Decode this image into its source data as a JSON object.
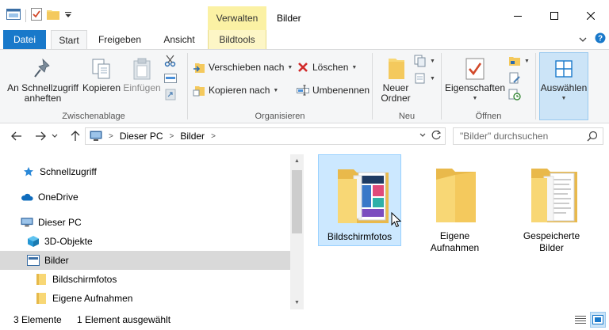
{
  "window": {
    "title": "Bilder",
    "context_header": "Verwalten"
  },
  "tabs": {
    "datei": "Datei",
    "start": "Start",
    "freigeben": "Freigeben",
    "ansicht": "Ansicht",
    "bildtools": "Bildtools"
  },
  "ribbon": {
    "zwischenablage": {
      "label": "Zwischenablage",
      "pin_line1": "An Schnellzugriff",
      "pin_line2": "anheften",
      "copy": "Kopieren",
      "paste": "Einfügen"
    },
    "organisieren": {
      "label": "Organisieren",
      "move_to": "Verschieben nach",
      "copy_to": "Kopieren nach",
      "delete": "Löschen",
      "rename": "Umbenennen"
    },
    "neu": {
      "label": "Neu",
      "new_folder_line1": "Neuer",
      "new_folder_line2": "Ordner"
    },
    "oeffnen": {
      "label": "Öffnen",
      "properties": "Eigenschaften"
    },
    "auswaehlen": {
      "select": "Auswählen"
    }
  },
  "address": {
    "crumbs": [
      "Dieser PC",
      "Bilder"
    ],
    "search_placeholder": "\"Bilder\" durchsuchen"
  },
  "navpane": {
    "items": [
      {
        "label": "Schnellzugriff"
      },
      {
        "label": "OneDrive"
      },
      {
        "label": "Dieser PC"
      },
      {
        "label": "3D-Objekte"
      },
      {
        "label": "Bilder"
      },
      {
        "label": "Bildschirmfotos"
      },
      {
        "label": "Eigene Aufnahmen"
      }
    ]
  },
  "content": {
    "folders": [
      {
        "label": "Bildschirmfotos"
      },
      {
        "label": "Eigene Aufnahmen"
      },
      {
        "label": "Gespeicherte Bilder"
      }
    ]
  },
  "status": {
    "count": "3 Elemente",
    "selection": "1 Element ausgewählt"
  },
  "colors": {
    "accent": "#1979ca",
    "context_tab": "#fbf1a4",
    "selection": "#cce8ff",
    "folder": "#f8d775"
  }
}
